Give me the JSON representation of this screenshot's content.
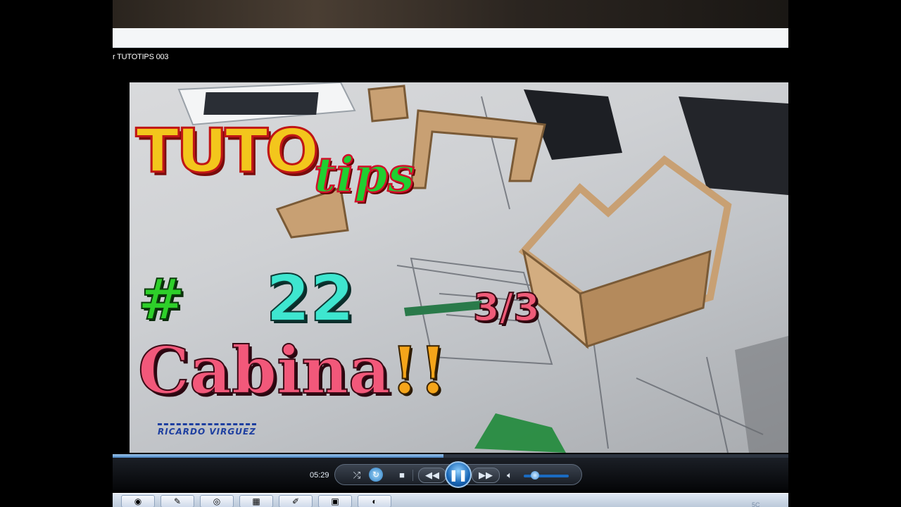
{
  "player": {
    "title": "r TUTOTIPS 003",
    "elapsed": "05:29",
    "progress": 0.49,
    "volume_level": 0.25,
    "icons": [
      "shuffle-icon",
      "repeat-icon",
      "stop-icon",
      "previous-icon",
      "pause-icon",
      "next-icon",
      "volume-icon"
    ]
  },
  "overlay": {
    "logo_main": "TUTO",
    "logo_script": "tips",
    "hash": "#",
    "episode": "22",
    "part": "3/3",
    "subject": "Cabina",
    "exclaim": "!!",
    "credit": "RICARDO VIRGUEZ"
  },
  "taskbar": {
    "icons": [
      "windows-media-player-icon",
      "paint-icon",
      "chrome-icon",
      "excel-icon",
      "pen-icon",
      "photos-icon",
      "app-icon"
    ],
    "clock_fragment": "5C"
  },
  "colors": {
    "logo_yellow": "#f3c61c",
    "logo_red": "#c01616",
    "tips_green": "#1fcf30",
    "episode_cyan": "#3ee6cf",
    "subject_pink": "#f2587a",
    "exclaim_orange": "#f5a51a",
    "seek_blue": "#4a86c4"
  }
}
